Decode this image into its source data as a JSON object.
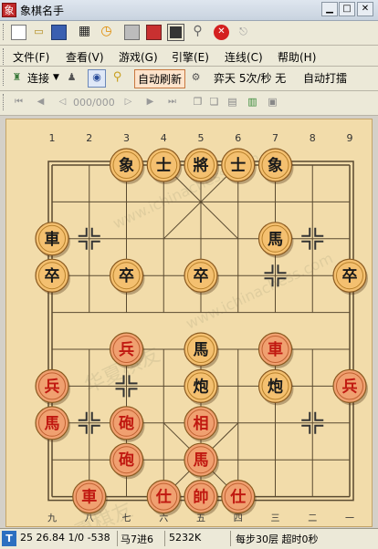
{
  "window": {
    "title": "象棋名手",
    "app_icon_glyph": "象"
  },
  "menu": [
    "文件(F)",
    "查看(V)",
    "游戏(G)",
    "引擎(E)",
    "连线(C)",
    "帮助(H)"
  ],
  "toolbar2": {
    "connect_label": "连接",
    "auto_refresh_label": "自动刷新",
    "engine_info": "弈天 5次/秒 无",
    "auto_play_label": "自动打擂"
  },
  "toolbar3": {
    "move_counter": "000/000"
  },
  "board": {
    "top_file_labels": [
      "1",
      "2",
      "3",
      "4",
      "5",
      "6",
      "7",
      "8",
      "9"
    ],
    "bottom_file_labels": [
      "九",
      "八",
      "七",
      "六",
      "五",
      "四",
      "三",
      "二",
      "一"
    ],
    "watermark_text": [
      "www.ichinachess.com",
      "华夏棋友"
    ],
    "black_color": "#1a1a1a",
    "red_color": "#c01810",
    "pieces": [
      {
        "label": "象",
        "side": "black",
        "file": 2,
        "rank": 0
      },
      {
        "label": "士",
        "side": "black",
        "file": 3,
        "rank": 0
      },
      {
        "label": "將",
        "side": "black",
        "file": 4,
        "rank": 0
      },
      {
        "label": "士",
        "side": "black",
        "file": 5,
        "rank": 0
      },
      {
        "label": "象",
        "side": "black",
        "file": 6,
        "rank": 0
      },
      {
        "label": "車",
        "side": "black",
        "file": 0,
        "rank": 2
      },
      {
        "label": "馬",
        "side": "black",
        "file": 6,
        "rank": 2
      },
      {
        "label": "卒",
        "side": "black",
        "file": 0,
        "rank": 3
      },
      {
        "label": "卒",
        "side": "black",
        "file": 2,
        "rank": 3
      },
      {
        "label": "卒",
        "side": "black",
        "file": 4,
        "rank": 3
      },
      {
        "label": "卒",
        "side": "black",
        "file": 8,
        "rank": 3
      },
      {
        "label": "兵",
        "side": "red",
        "file": 2,
        "rank": 5
      },
      {
        "label": "馬",
        "side": "black",
        "file": 4,
        "rank": 5
      },
      {
        "label": "車",
        "side": "red",
        "file": 6,
        "rank": 5
      },
      {
        "label": "兵",
        "side": "red",
        "file": 0,
        "rank": 6
      },
      {
        "label": "炮",
        "side": "black",
        "file": 4,
        "rank": 6
      },
      {
        "label": "炮",
        "side": "black",
        "file": 6,
        "rank": 6
      },
      {
        "label": "兵",
        "side": "red",
        "file": 8,
        "rank": 6
      },
      {
        "label": "馬",
        "side": "red",
        "file": 0,
        "rank": 7
      },
      {
        "label": "砲",
        "side": "red",
        "file": 2,
        "rank": 7
      },
      {
        "label": "相",
        "side": "red",
        "file": 4,
        "rank": 7
      },
      {
        "label": "砲",
        "side": "red",
        "file": 2,
        "rank": 8
      },
      {
        "label": "馬",
        "side": "red",
        "file": 4,
        "rank": 8
      },
      {
        "label": "車",
        "side": "red",
        "file": 1,
        "rank": 9
      },
      {
        "label": "仕",
        "side": "red",
        "file": 3,
        "rank": 9
      },
      {
        "label": "帥",
        "side": "red",
        "file": 4,
        "rank": 9
      },
      {
        "label": "仕",
        "side": "red",
        "file": 5,
        "rank": 9
      }
    ],
    "markers": [
      {
        "file": 1,
        "rank": 2
      },
      {
        "file": 7,
        "rank": 2
      },
      {
        "file": 6,
        "rank": 3
      },
      {
        "file": 2,
        "rank": 6
      },
      {
        "file": 1,
        "rank": 7
      },
      {
        "file": 7,
        "rank": 7
      }
    ]
  },
  "status": {
    "score": "25 26.84 1/0 -538",
    "last_move": "马7进6",
    "nodes": "5232K",
    "depth": "每步30层 超时0秒"
  }
}
